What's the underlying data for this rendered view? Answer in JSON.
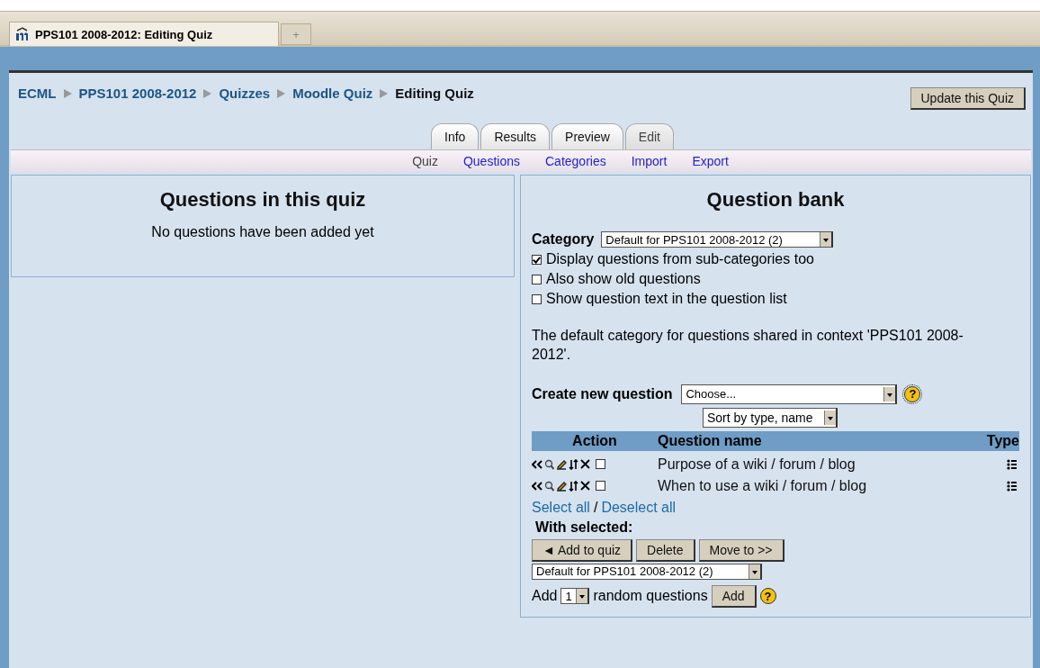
{
  "browser_tab": {
    "title": "PPS101 2008-2012: Editing Quiz",
    "new_tab": "+"
  },
  "breadcrumb": [
    {
      "label": "ECML",
      "current": false
    },
    {
      "label": "PPS101 2008-2012",
      "current": false
    },
    {
      "label": "Quizzes",
      "current": false
    },
    {
      "label": "Moodle Quiz",
      "current": false
    },
    {
      "label": "Editing Quiz",
      "current": true
    }
  ],
  "update_button": "Update this Quiz",
  "tabs": [
    {
      "label": "Info",
      "selected": false
    },
    {
      "label": "Results",
      "selected": false
    },
    {
      "label": "Preview",
      "selected": false
    },
    {
      "label": "Edit",
      "selected": true
    }
  ],
  "subtabs": [
    {
      "label": "Quiz",
      "selected": true
    },
    {
      "label": "Questions",
      "selected": false
    },
    {
      "label": "Categories",
      "selected": false
    },
    {
      "label": "Import",
      "selected": false
    },
    {
      "label": "Export",
      "selected": false
    }
  ],
  "quiz_panel": {
    "title": "Questions in this quiz",
    "message": "No questions have been added yet"
  },
  "bank": {
    "title": "Question bank",
    "category_label": "Category",
    "category_value": "Default for PPS101 2008-2012 (2)",
    "options": [
      {
        "label": "Display questions from sub-categories too",
        "checked": true
      },
      {
        "label": "Also show old questions",
        "checked": false
      },
      {
        "label": "Show question text in the question list",
        "checked": false
      }
    ],
    "info": "The default category for questions shared in context 'PPS101 2008-2012'.",
    "create_label": "Create new question",
    "create_value": "Choose...",
    "help": "?",
    "sort_value": "Sort by type, name",
    "columns": [
      "Action",
      "Question name",
      "Type"
    ],
    "rows": [
      {
        "name": "Purpose of a wiki / forum / blog",
        "checked": false
      },
      {
        "name": "When to use a wiki / forum / blog",
        "checked": false
      }
    ],
    "select_all": "Select all",
    "separator": "/",
    "deselect_all": "Deselect all",
    "with_selected": "With selected:",
    "buttons": [
      "◄ Add to quiz",
      "Delete",
      "Move to >>"
    ],
    "move_target": "Default for PPS101 2008-2012 (2)",
    "random": {
      "prefix": "Add",
      "count": "1",
      "suffix": "random questions",
      "button": "Add",
      "help": "?"
    }
  }
}
